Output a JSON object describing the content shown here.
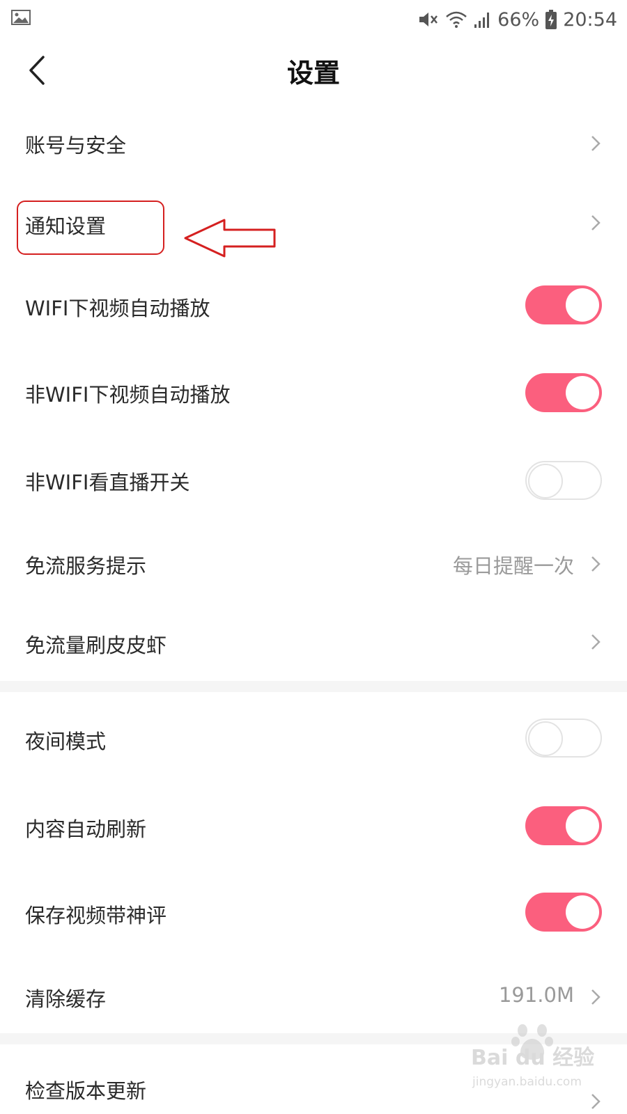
{
  "status_bar": {
    "battery": "66%",
    "time": "20:54"
  },
  "header": {
    "title": "设置"
  },
  "rows": [
    {
      "label": "账号与安全",
      "type": "nav"
    },
    {
      "label": "通知设置",
      "type": "nav"
    },
    {
      "label": "WIFI下视频自动播放",
      "type": "toggle",
      "on": true
    },
    {
      "label": "非WIFI下视频自动播放",
      "type": "toggle",
      "on": true
    },
    {
      "label": "非WIFI看直播开关",
      "type": "toggle",
      "on": false
    },
    {
      "label": "免流服务提示",
      "type": "nav",
      "value": "每日提醒一次"
    },
    {
      "label": "免流量刷皮皮虾",
      "type": "nav"
    },
    {
      "label": "夜间模式",
      "type": "toggle",
      "on": false
    },
    {
      "label": "内容自动刷新",
      "type": "toggle",
      "on": true
    },
    {
      "label": "保存视频带神评",
      "type": "toggle",
      "on": true
    },
    {
      "label": "清除缓存",
      "type": "nav",
      "value": "191.0M"
    },
    {
      "label": "检查版本更新",
      "type": "nav"
    }
  ],
  "colors": {
    "toggle_on": "#fb5f7e",
    "annotation": "#d52020"
  },
  "watermark": {
    "brand": "Bai du 经验",
    "url": "jingyan.baidu.com"
  }
}
